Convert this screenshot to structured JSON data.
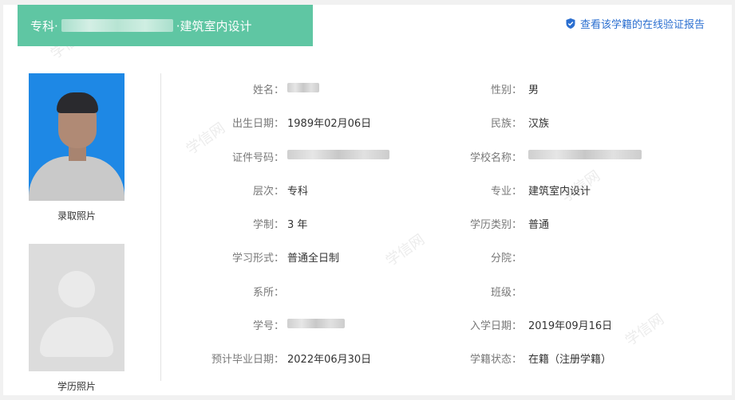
{
  "header": {
    "title_prefix": "专科·",
    "title_suffix": "·建筑室内设计",
    "verify_link": "查看该学籍的在线验证报告"
  },
  "photos": {
    "admission_label": "录取照片",
    "diploma_label": "学历照片"
  },
  "fields": {
    "name_label": "姓名：",
    "gender_label": "性别：",
    "gender": "男",
    "birth_label": "出生日期：",
    "birth": "1989年02月06日",
    "ethnicity_label": "民族：",
    "ethnicity": "汉族",
    "id_label": "证件号码：",
    "school_label": "学校名称：",
    "level_label": "层次：",
    "level": "专科",
    "major_label": "专业：",
    "major": "建筑室内设计",
    "duration_label": "学制：",
    "duration": "3 年",
    "edu_type_label": "学历类别：",
    "edu_type": "普通",
    "study_form_label": "学习形式：",
    "study_form": "普通全日制",
    "branch_label": "分院：",
    "branch": "",
    "department_label": "系所：",
    "department": "",
    "class_label": "班级：",
    "class": "",
    "student_no_label": "学号：",
    "enroll_label": "入学日期：",
    "enroll": "2019年09月16日",
    "grad_label": "预计毕业日期：",
    "grad": "2022年06月30日",
    "status_label": "学籍状态：",
    "status": "在籍（注册学籍）"
  },
  "colors": {
    "header_bg": "#5fc6a3",
    "link": "#2b6fd0",
    "photo_bg": "#1e88e5"
  },
  "icons": {
    "verify": "shield-check-icon"
  }
}
